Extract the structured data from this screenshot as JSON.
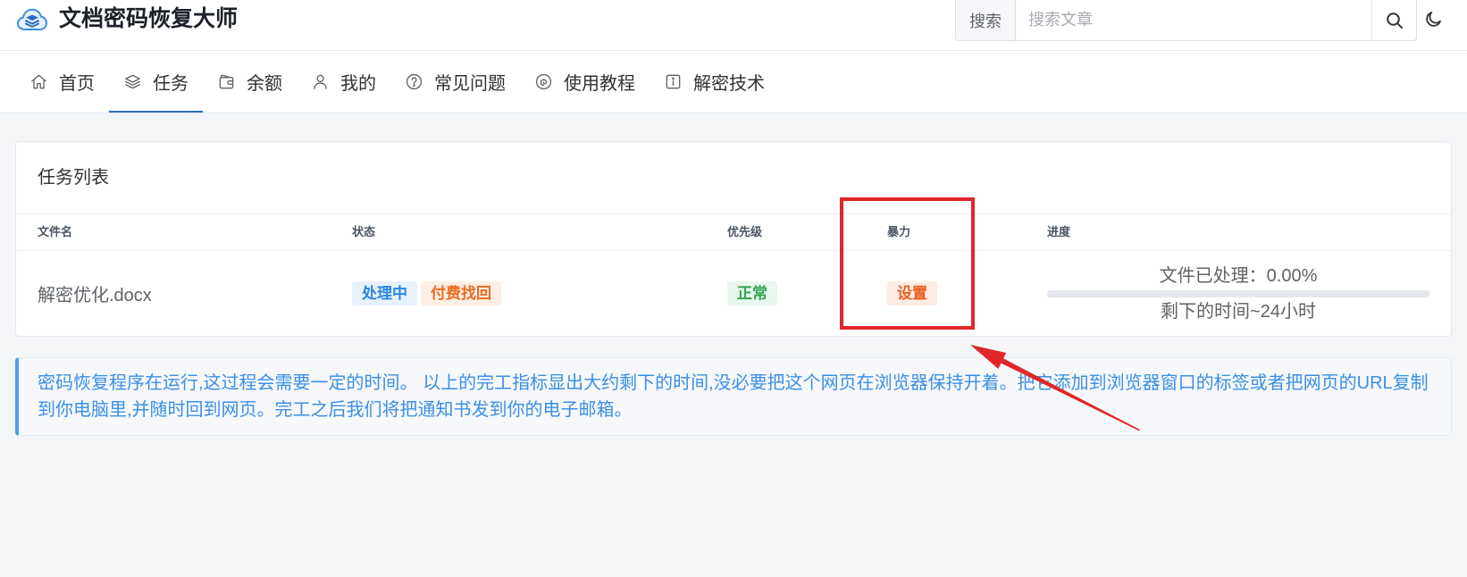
{
  "app": {
    "title": "文档密码恢复大师",
    "logo_icon": "cloud-layers-icon"
  },
  "search": {
    "label": "搜索",
    "placeholder": "搜索文章",
    "value": "",
    "button_icon": "search-icon"
  },
  "theme_toggle": {
    "icon": "moon-icon"
  },
  "nav": {
    "items": [
      {
        "label": "首页",
        "icon": "home-icon",
        "active": false
      },
      {
        "label": "任务",
        "icon": "layers-icon",
        "active": true
      },
      {
        "label": "余额",
        "icon": "wallet-icon",
        "active": false
      },
      {
        "label": "我的",
        "icon": "user-icon",
        "active": false
      },
      {
        "label": "常见问题",
        "icon": "question-circle-icon",
        "active": false
      },
      {
        "label": "使用教程",
        "icon": "tutorial-icon",
        "active": false
      },
      {
        "label": "解密技术",
        "icon": "info-square-icon",
        "active": false
      }
    ]
  },
  "task_card": {
    "title": "任务列表",
    "columns": {
      "file_name": "文件名",
      "status": "状态",
      "priority": "优先级",
      "brute_force": "暴力",
      "progress": "进度"
    },
    "rows": [
      {
        "file_name": "解密优化.docx",
        "status_tags": [
          {
            "label": "处理中",
            "color": "#2b87e3",
            "background": "#e7f1fc"
          },
          {
            "label": "付费找回",
            "color": "#ee6a1d",
            "background": "#fdefe5"
          }
        ],
        "priority": {
          "label": "正常",
          "color": "#2ea44f",
          "background": "#e8f6ed"
        },
        "brute_force": {
          "label": "设置",
          "color": "#ec5e1e",
          "background": "#fdece3"
        },
        "progress_text": "文件已处理：0.00%",
        "progress_percent": 0,
        "remaining_text": "剩下的时间~24小时"
      }
    ]
  },
  "notice": {
    "lines": [
      "密码恢复程序在运行,这过程会需要一定的时间。 以上的完工指标显出大约剩下的时间,没必要把这个网页在浏览器保持开着。把它添加到浏览器窗口的标签或者把网页的URL复制",
      "到你电脑里,并随时回到网页。完工之后我们将把通知书发到你的电子邮箱。"
    ]
  },
  "colors": {
    "accent": "#2f6fbd",
    "notice_text": "#3c8ee6",
    "notice_border": "#4a9ef2",
    "annotation": "#e0262b"
  }
}
